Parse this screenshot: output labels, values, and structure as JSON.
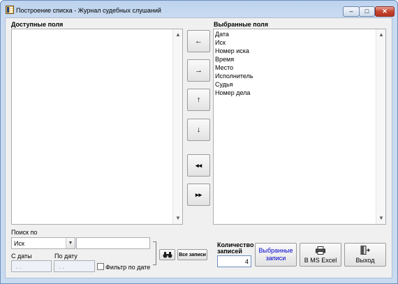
{
  "window": {
    "title": "Построение списка - Журнал судебных слушаний",
    "controls": {
      "minimize": "–",
      "maximize": "□",
      "close": "✕"
    }
  },
  "available": {
    "label": "Доступные поля",
    "items": []
  },
  "selected": {
    "label": "Выбранные поля",
    "items": [
      "Дата",
      "Иск",
      "Номер иска",
      "Время",
      "Место",
      "Исполнитель",
      "Судья",
      "Номер дела"
    ]
  },
  "move_buttons": {
    "move_left": "←",
    "move_right": "→",
    "move_up": "↑",
    "move_down": "↓",
    "move_all_left": "◂◂",
    "move_all_right": "▸▸"
  },
  "scroll": {
    "up": "▲",
    "down": "▼"
  },
  "search": {
    "label": "Поиск по",
    "field_value": "Иск",
    "dropdown_arrow": "▼",
    "text_value": ""
  },
  "date_filter": {
    "from_label": "С даты",
    "from_value": ". .",
    "to_label": "По дату",
    "to_value": ". .",
    "filter_label": "Фильтр по дате"
  },
  "buttons": {
    "all_records": "Все записи",
    "selected_records": "Выбранные записи",
    "excel": "В MS Excel",
    "exit": "Выход"
  },
  "records_count": {
    "label": "Количество записей",
    "value": "4"
  },
  "colors": {
    "accent_text": "#0000cc",
    "frame": "#c9dbf1",
    "close_button": "#c6442f"
  },
  "icons": {
    "app": "app-list-icon",
    "search": "binoculars-icon",
    "excel": "printer-icon",
    "exit": "exit-door-icon"
  }
}
